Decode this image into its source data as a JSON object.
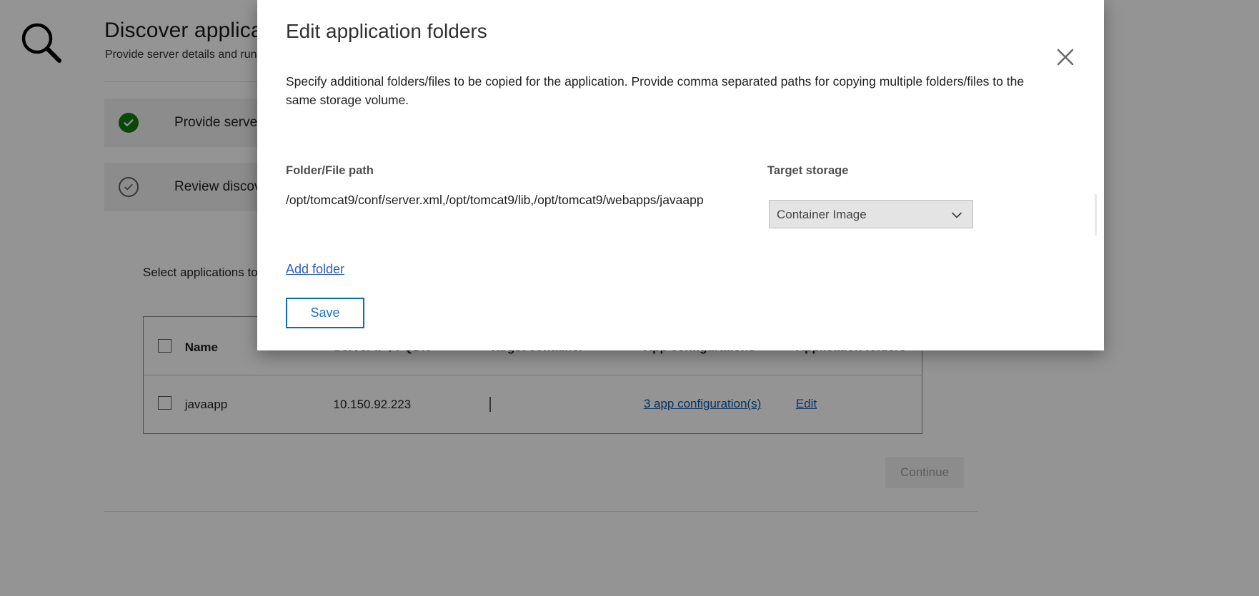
{
  "background": {
    "icon": "search-icon",
    "title": "Discover applications",
    "subtitle": "Provide server details and run discovery",
    "steps": [
      {
        "label": "Provide server details",
        "state": "completed",
        "icon": "check-circle-filled-icon"
      },
      {
        "label": "Review discovered applications",
        "state": "current",
        "icon": "check-circle-outline-icon"
      }
    ],
    "select_apps_text": "Select applications to containerize",
    "table": {
      "columns": [
        {
          "key": "check",
          "label": ""
        },
        {
          "key": "name",
          "label": "Name"
        },
        {
          "key": "ip",
          "label": "Server IP / FQDN"
        },
        {
          "key": "target_container",
          "label": "Target container"
        },
        {
          "key": "app_configurations",
          "label": "App configurations"
        },
        {
          "key": "application_folders",
          "label": "Application folders"
        }
      ],
      "rows": [
        {
          "name": "javaapp",
          "ip": "10.150.92.223",
          "target_container": "",
          "app_configurations": "3 app configuration(s)",
          "application_folders": "Edit"
        }
      ]
    },
    "continue_label": "Continue"
  },
  "modal": {
    "title": "Edit application folders",
    "close_icon": "close-icon",
    "description": "Specify additional folders/files to be copied for the application. Provide comma separated paths for copying multiple folders/files to the same storage volume.",
    "path_label": "Folder/File path",
    "storage_label": "Target storage",
    "path_value": "/opt/tomcat9/conf/server.xml,/opt/tomcat9/lib,/opt/tomcat9/webapps/javaapp",
    "storage_value": "Container Image",
    "storage_options": [
      "Container Image"
    ],
    "add_folder_label": "Add folder",
    "save_label": "Save",
    "chevron_icon": "chevron-down-icon"
  },
  "colors": {
    "accent_blue": "#0f6cbd",
    "link_blue": "#2c5cc5",
    "success_green": "#107c10",
    "scrim": "rgba(0,0,0,0.42)"
  }
}
